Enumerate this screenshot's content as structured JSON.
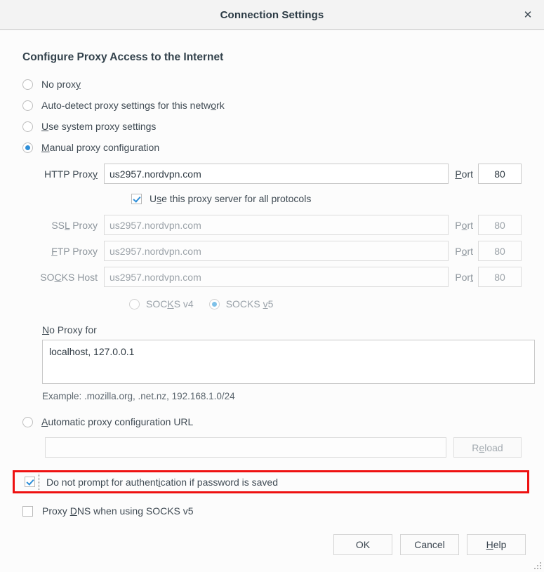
{
  "window": {
    "title": "Connection Settings",
    "close_icon": "close-icon"
  },
  "section": {
    "heading": "Configure Proxy Access to the Internet"
  },
  "proxy_mode": {
    "options": [
      {
        "label": "No proxy",
        "pre": "No prox",
        "ak": "y",
        "post": "",
        "selected": false
      },
      {
        "label": "Auto-detect proxy settings for this network",
        "pre": "Auto-detect proxy settings for this netw",
        "ak": "o",
        "post": "rk",
        "selected": false
      },
      {
        "label": "Use system proxy settings",
        "pre": "",
        "ak": "U",
        "post": "se system proxy settings",
        "selected": false
      },
      {
        "label": "Manual proxy configuration",
        "pre": "",
        "ak": "M",
        "post": "anual proxy configuration",
        "selected": true
      }
    ]
  },
  "manual": {
    "http": {
      "label_pre": "HTTP Prox",
      "label_ak": "y",
      "label_post": "",
      "value": "us2957.nordvpn.com",
      "port_pre": "",
      "port_ak": "P",
      "port_post": "ort",
      "port_value": "80"
    },
    "all_protocols": {
      "pre": "U",
      "ak": "s",
      "post": "e this proxy server for all protocols",
      "checked": true
    },
    "ssl": {
      "label_pre": "SS",
      "label_ak": "L",
      "label_post": " Proxy",
      "value": "us2957.nordvpn.com",
      "port_pre": "P",
      "port_ak": "o",
      "port_post": "rt",
      "port_value": "80"
    },
    "ftp": {
      "label_pre": "",
      "label_ak": "F",
      "label_post": "TP Proxy",
      "value": "us2957.nordvpn.com",
      "port_pre": "P",
      "port_ak": "o",
      "port_post": "rt",
      "port_value": "80"
    },
    "socks": {
      "label_pre": "SO",
      "label_ak": "C",
      "label_post": "KS Host",
      "value": "us2957.nordvpn.com",
      "port_pre": "Por",
      "port_ak": "t",
      "port_post": "",
      "port_value": "80"
    },
    "socks_version": {
      "v4": {
        "pre": "SOC",
        "ak": "K",
        "post": "S v4",
        "selected": false
      },
      "v5": {
        "pre": "SOCKS ",
        "ak": "v",
        "post": "5",
        "selected": true
      }
    }
  },
  "no_proxy": {
    "label_pre": "",
    "label_ak": "N",
    "label_post": "o Proxy for",
    "value": "localhost, 127.0.0.1",
    "example": "Example: .mozilla.org, .net.nz, 192.168.1.0/24"
  },
  "pac": {
    "radio_pre": "",
    "radio_ak": "A",
    "radio_post": "utomatic proxy configuration URL",
    "selected": false,
    "url_value": "",
    "url_placeholder": "",
    "reload_pre": "R",
    "reload_ak": "e",
    "reload_post": "load"
  },
  "options": {
    "no_prompt": {
      "pre": "Do not prompt for authent",
      "ak": "i",
      "post": "cation if password is saved",
      "checked": true,
      "highlight_color": "#ee1111"
    },
    "proxy_dns": {
      "pre": "Proxy ",
      "ak": "D",
      "post": "NS when using SOCKS v5",
      "checked": false
    }
  },
  "footer": {
    "ok": "OK",
    "cancel": "Cancel",
    "help_pre": "",
    "help_ak": "H",
    "help_post": "elp"
  },
  "colors": {
    "accent": "#2f8fd8",
    "accent_dim": "#7fc1e8",
    "highlight": "#ee1111",
    "titlebar_bg": "#f3f3f3",
    "body_bg": "#fcfcfc"
  }
}
